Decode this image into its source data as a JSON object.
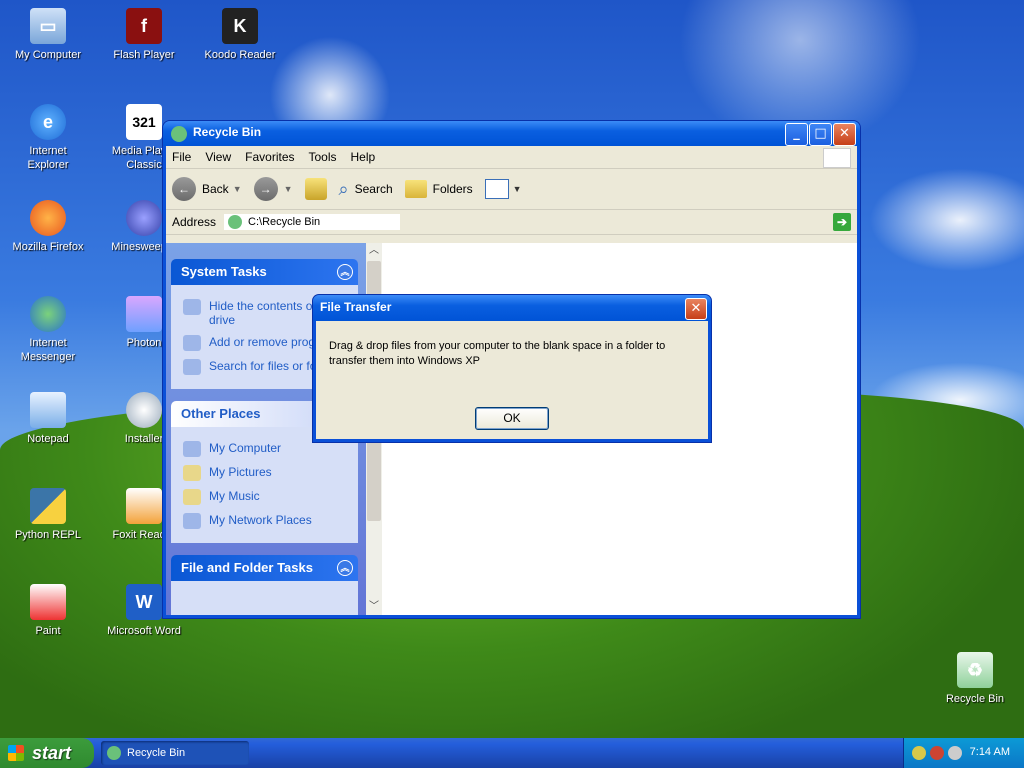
{
  "desktop": {
    "icons": [
      {
        "label": "My Computer"
      },
      {
        "label": "Flash Player"
      },
      {
        "label": "Koodo Reader"
      },
      {
        "label": "Internet Explorer"
      },
      {
        "label": "Media Player Classic"
      },
      {
        "label": "Mozilla Firefox"
      },
      {
        "label": "Minesweeper"
      },
      {
        "label": "Internet Messenger"
      },
      {
        "label": "Photon"
      },
      {
        "label": "Notepad"
      },
      {
        "label": "Installer"
      },
      {
        "label": "Python REPL"
      },
      {
        "label": "Foxit Reader"
      },
      {
        "label": "Paint"
      },
      {
        "label": "Microsoft Word"
      },
      {
        "label": "Recycle Bin"
      }
    ]
  },
  "explorer": {
    "title": "Recycle Bin",
    "menu": [
      "File",
      "View",
      "Favorites",
      "Tools",
      "Help"
    ],
    "toolbar": {
      "back": "Back",
      "search": "Search",
      "folders": "Folders"
    },
    "address": {
      "label": "Address",
      "value": "C:\\Recycle Bin"
    },
    "system_tasks": {
      "title": "System Tasks",
      "items": [
        "Hide the contents of this drive",
        "Add or remove programs",
        "Search for files or folders"
      ]
    },
    "other_places": {
      "title": "Other Places",
      "items": [
        "My Computer",
        "My Pictures",
        "My Music",
        "My Network Places"
      ]
    },
    "file_folder_tasks": {
      "title": "File and Folder Tasks"
    }
  },
  "dialog": {
    "title": "File Transfer",
    "message": "Drag & drop files from your computer to the blank space in a folder to transfer them into Windows XP",
    "ok": "OK"
  },
  "taskbar": {
    "start": "start",
    "task": "Recycle Bin",
    "time": "7:14 AM"
  }
}
